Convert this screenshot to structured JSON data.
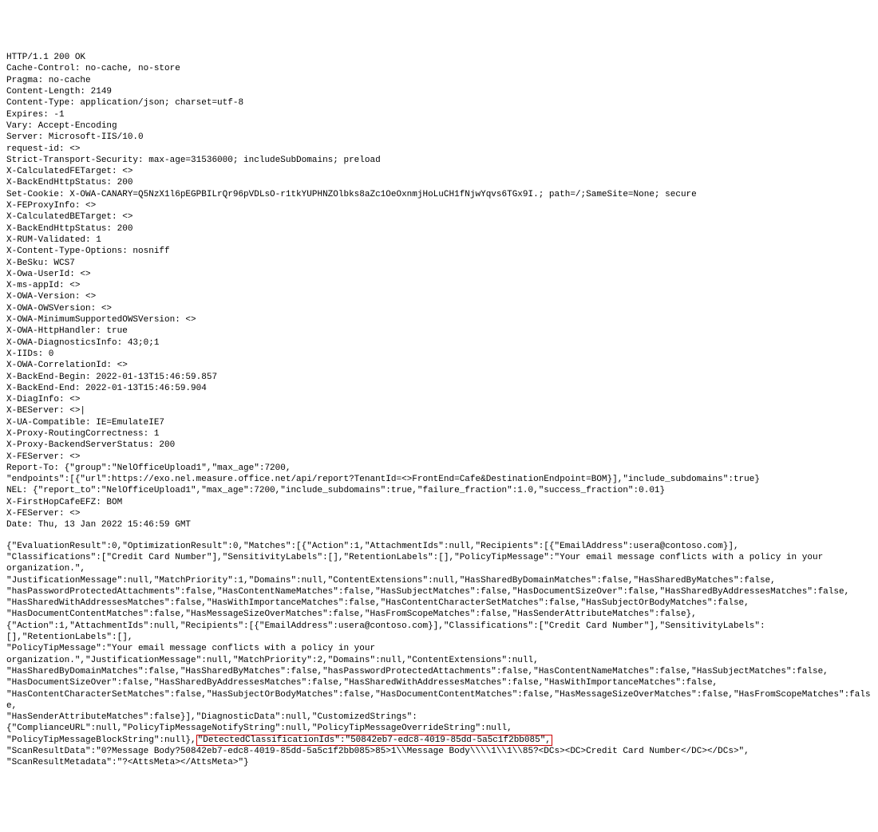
{
  "headers": [
    "HTTP/1.1 200 OK",
    "Cache-Control: no-cache, no-store",
    "Pragma: no-cache",
    "Content-Length: 2149",
    "Content-Type: application/json; charset=utf-8",
    "Expires: -1",
    "Vary: Accept-Encoding",
    "Server: Microsoft-IIS/10.0",
    "request-id: <>",
    "Strict-Transport-Security: max-age=31536000; includeSubDomains; preload",
    "X-CalculatedFETarget: <>",
    "X-BackEndHttpStatus: 200",
    "Set-Cookie: X-OWA-CANARY=Q5NzX1l6pEGPBILrQr96pVDLsO-r1tkYUPHNZOlbks8aZc1OeOxnmjHoLuCH1fNjwYqvs6TGx9I.; path=/;SameSite=None; secure",
    "X-FEProxyInfo: <>",
    "X-CalculatedBETarget: <>",
    "X-BackEndHttpStatus: 200",
    "X-RUM-Validated: 1",
    "X-Content-Type-Options: nosniff",
    "X-BeSku: WCS7",
    "X-Owa-UserId: <>",
    "X-ms-appId: <>",
    "X-OWA-Version: <>",
    "X-OWA-OWSVersion: <>",
    "X-OWA-MinimumSupportedOWSVersion: <>",
    "X-OWA-HttpHandler: true",
    "X-OWA-DiagnosticsInfo: 43;0;1",
    "X-IIDs: 0",
    "X-OWA-CorrelationId: <>",
    "X-BackEnd-Begin: 2022-01-13T15:46:59.857",
    "X-BackEnd-End: 2022-01-13T15:46:59.904",
    "X-DiagInfo: <>",
    "X-BEServer: <>|",
    "X-UA-Compatible: IE=EmulateIE7",
    "X-Proxy-RoutingCorrectness: 1",
    "X-Proxy-BackendServerStatus: 200",
    "X-FEServer: <>",
    "Report-To: {\"group\":\"NelOfficeUpload1\",\"max_age\":7200,",
    "\"endpoints\":[{\"url\":https://exo.nel.measure.office.net/api/report?TenantId=<>FrontEnd=Cafe&DestinationEndpoint=BOM}],\"include_subdomains\":true}",
    "NEL: {\"report_to\":\"NelOfficeUpload1\",\"max_age\":7200,\"include_subdomains\":true,\"failure_fraction\":1.0,\"success_fraction\":0.01}",
    "X-FirstHopCafeEFZ: BOM",
    "X-FEServer: <>",
    "Date: Thu, 13 Jan 2022 15:46:59 GMT"
  ],
  "body_pre": "{\"EvaluationResult\":0,\"OptimizationResult\":0,\"Matches\":[{\"Action\":1,\"AttachmentIds\":null,\"Recipients\":[{\"EmailAddress\":usera@contoso.com}],\n\"Classifications\":[\"Credit Card Number\"],\"SensitivityLabels\":[],\"RetentionLabels\":[],\"PolicyTipMessage\":\"Your email message conflicts with a policy in your organization.\",\n\"JustificationMessage\":null,\"MatchPriority\":1,\"Domains\":null,\"ContentExtensions\":null,\"HasSharedByDomainMatches\":false,\"HasSharedByMatches\":false,\n\"hasPasswordProtectedAttachments\":false,\"HasContentNameMatches\":false,\"HasSubjectMatches\":false,\"HasDocumentSizeOver\":false,\"HasSharedByAddressesMatches\":false,\n\"HasSharedWithAddressesMatches\":false,\"HasWithImportanceMatches\":false,\"HasContentCharacterSetMatches\":false,\"HasSubjectOrBodyMatches\":false,\n\"HasDocumentContentMatches\":false,\"HasMessageSizeOverMatches\":false,\"HasFromScopeMatches\":false,\"HasSenderAttributeMatches\":false},\n{\"Action\":1,\"AttachmentIds\":null,\"Recipients\":[{\"EmailAddress\":usera@contoso.com}],\"Classifications\":[\"Credit Card Number\"],\"SensitivityLabels\":[],\"RetentionLabels\":[],\n\"PolicyTipMessage\":\"Your email message conflicts with a policy in your organization.\",\"JustificationMessage\":null,\"MatchPriority\":2,\"Domains\":null,\"ContentExtensions\":null,\n\"HasSharedByDomainMatches\":false,\"HasSharedByMatches\":false,\"hasPasswordProtectedAttachments\":false,\"HasContentNameMatches\":false,\"HasSubjectMatches\":false,\n\"HasDocumentSizeOver\":false,\"HasSharedByAddressesMatches\":false,\"HasSharedWithAddressesMatches\":false,\"HasWithImportanceMatches\":false,\n\"HasContentCharacterSetMatches\":false,\"HasSubjectOrBodyMatches\":false,\"HasDocumentContentMatches\":false,\"HasMessageSizeOverMatches\":false,\"HasFromScopeMatches\":false,\n\"HasSenderAttributeMatches\":false}],\"DiagnosticData\":null,\"CustomizedStrings\":{\"ComplianceURL\":null,\"PolicyTipMessageNotifyString\":null,\"PolicyTipMessageOverrideString\":null,\n\"PolicyTipMessageBlockString\":null},",
  "highlight": "\"DetectedClassificationIds\":\"50842eb7-edc8-4019-85dd-5a5c1f2bb085\",",
  "body_post": "\n\"ScanResultData\":\"0?Message Body?50842eb7-edc8-4019-85dd-5a5c1f2bb085>85>1\\\\Message Body\\\\\\\\1\\\\1\\\\85?<DCs><DC>Credit Card Number</DC></DCs>\",\n\"ScanResultMetadata\":\"?<AttsMeta></AttsMeta>\"}"
}
